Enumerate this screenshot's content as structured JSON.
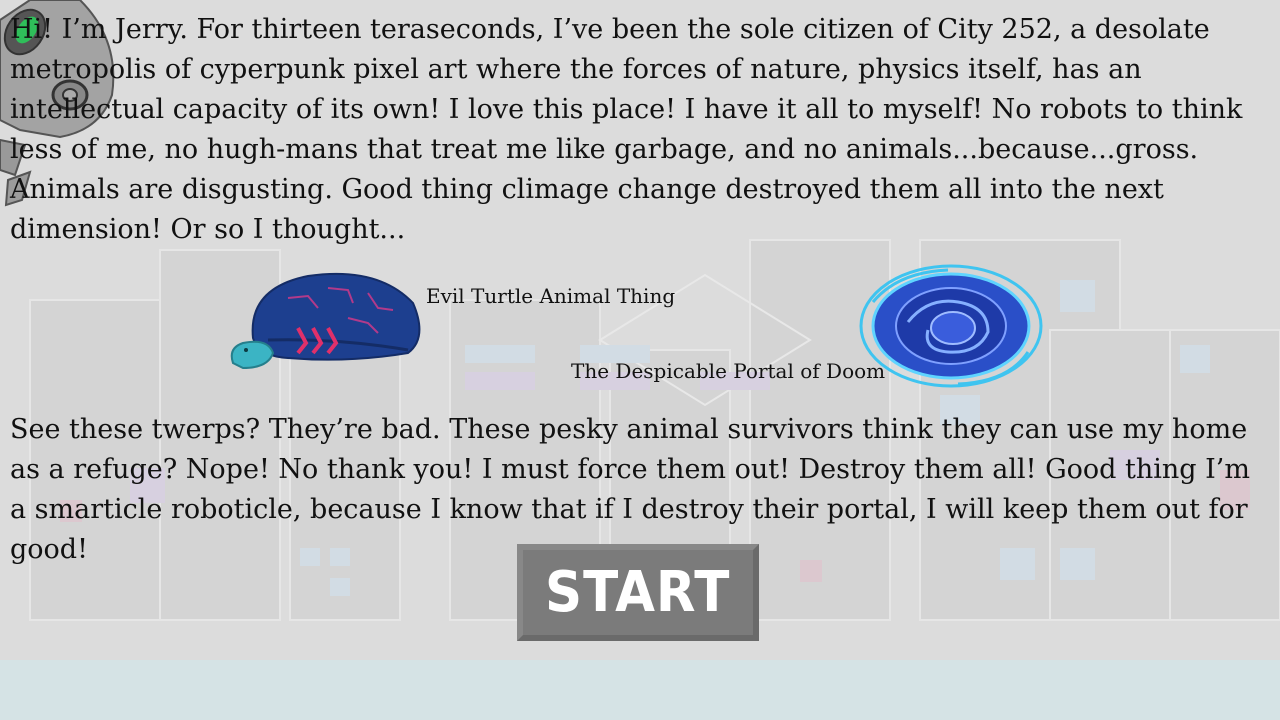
{
  "intro_text": "Hi! I’m Jerry. For thirteen teraseconds, I’ve been the sole citizen of City 252, a desolate metropolis of cyperpunk pixel art where the forces of nature, physics itself, has an intellectual capacity of its own! I love this place! I have it all to myself! No robots to think less of me, no hugh-mans that treat me like garbage, and no animals...because...gross. Animals are disgusting. Good thing climage change destroyed them all into the next dimension! Or so I thought...",
  "turtle_label": "Evil Turtle Animal Thing",
  "portal_label": "The Despicable Portal of Doom",
  "story_text": "See these twerps? They’re bad. These pesky animal survivors think they can use my home as a refuge? Nope! No thank you! I must force them out! Destroy them all! Good thing I’m a smarticle roboticle, because I know that if I destroy their portal, I will keep them out for good!",
  "start_button": "START",
  "colors": {
    "background": "#dcdcdc",
    "ground": "#d5e3e5",
    "robot": "#a0a0a0",
    "robot_eye": "#2fbf5a",
    "turtle_shell": "#1d3f8f",
    "turtle_accent": "#e0306a",
    "turtle_head": "#3bb4c4",
    "portal": "#2a4fc8",
    "portal_glow": "#3fc4f0",
    "button": "#7b7b7b"
  },
  "icons": [
    "robot-jerry-icon",
    "turtle-icon",
    "portal-icon"
  ]
}
